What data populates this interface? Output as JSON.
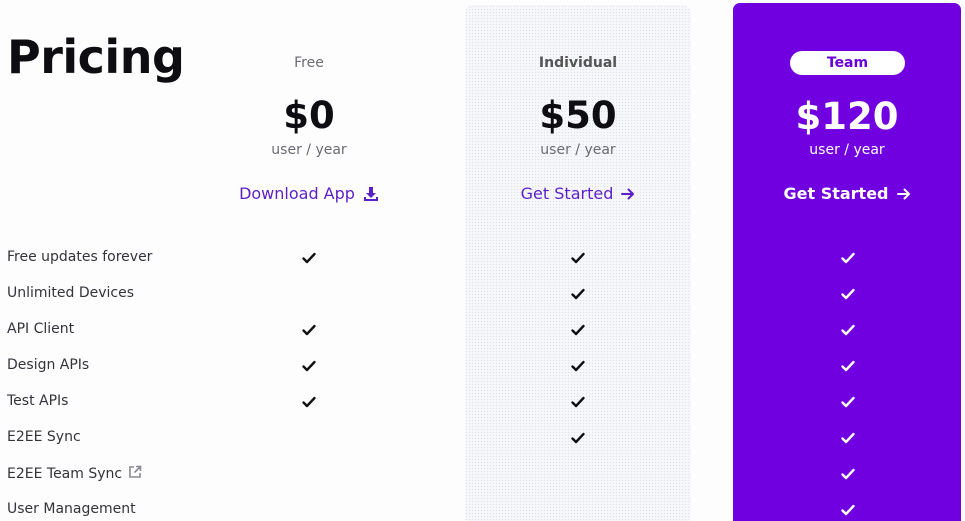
{
  "page": {
    "title": "Pricing"
  },
  "plans": [
    {
      "name": "Free",
      "price": "$0",
      "period": "user / year",
      "cta_label": "Download App",
      "cta_icon": "download-icon"
    },
    {
      "name": "Individual",
      "price": "$50",
      "period": "user / year",
      "cta_label": "Get Started",
      "cta_icon": "arrow-right-icon"
    },
    {
      "name": "Team",
      "price": "$120",
      "period": "user / year",
      "cta_label": "Get Started",
      "cta_icon": "arrow-right-icon"
    }
  ],
  "features": [
    {
      "label": "Free updates forever",
      "free": true,
      "individual": true,
      "team": true
    },
    {
      "label": "Unlimited Devices",
      "free": false,
      "individual": true,
      "team": true
    },
    {
      "label": "API Client",
      "free": true,
      "individual": true,
      "team": true
    },
    {
      "label": "Design APIs",
      "free": true,
      "individual": true,
      "team": true
    },
    {
      "label": "Test APIs",
      "free": true,
      "individual": true,
      "team": true
    },
    {
      "label": "E2EE Sync",
      "free": false,
      "individual": true,
      "team": true
    },
    {
      "label": "E2EE Team Sync",
      "free": false,
      "individual": false,
      "team": true,
      "external_link_icon": "external-link-icon"
    },
    {
      "label": "User Management",
      "free": false,
      "individual": false,
      "team": true
    }
  ],
  "colors": {
    "accent": "#7000e0",
    "link": "#5b1fc7"
  }
}
